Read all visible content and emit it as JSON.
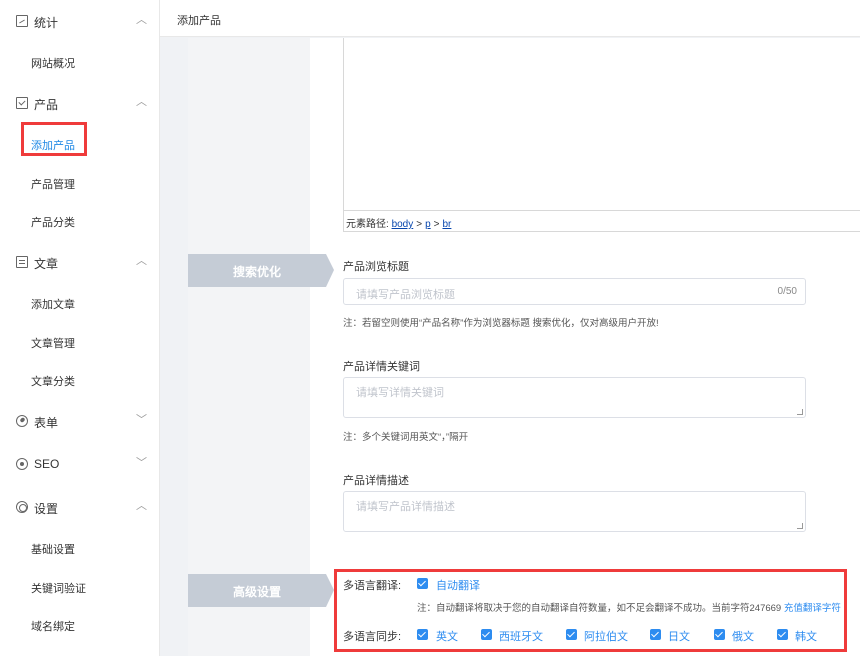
{
  "sidebar": {
    "groups": [
      {
        "label": "统计",
        "icon": "chart-icon",
        "expanded": true,
        "items": [
          "网站概况"
        ]
      },
      {
        "label": "产品",
        "icon": "box-icon",
        "expanded": true,
        "items": [
          "添加产品",
          "产品管理",
          "产品分类"
        ]
      },
      {
        "label": "文章",
        "icon": "document-icon",
        "expanded": true,
        "items": [
          "添加文章",
          "文章管理",
          "文章分类"
        ]
      },
      {
        "label": "表单",
        "icon": "check-circle-icon",
        "expanded": false,
        "items": []
      },
      {
        "label": "SEO",
        "icon": "target-icon",
        "expanded": false,
        "items": []
      },
      {
        "label": "设置",
        "icon": "gear-icon",
        "expanded": true,
        "items": [
          "基础设置",
          "关键词验证",
          "域名绑定"
        ]
      }
    ],
    "active_item": "添加产品"
  },
  "header": {
    "title": "添加产品"
  },
  "editor": {
    "path_label": "元素路径:",
    "path": [
      "body",
      "p",
      "br"
    ]
  },
  "seo": {
    "section_title": "搜索优化",
    "browse_title": {
      "label": "产品浏览标题",
      "placeholder": "请填写产品浏览标题",
      "counter": "0/50",
      "note": "注：若留空则使用“产品名称”作为浏览器标题  搜索优化，仅对高级用户开放!"
    },
    "keywords": {
      "label": "产品详情关键词",
      "placeholder": "请填写详情关键词",
      "note": "注：多个关键词用英文“，”隔开"
    },
    "description": {
      "label": "产品详情描述",
      "placeholder": "请填写产品详情描述"
    }
  },
  "advanced": {
    "section_title": "高级设置",
    "translate_label": "多语言翻译:",
    "auto_translate": "自动翻译",
    "translate_note": "注：自动翻译将取决于您的自动翻译自符数量，如不足会翻译不成功。当前字符247669",
    "recharge_link": "充值翻译字符",
    "sync_label": "多语言同步:",
    "languages": [
      "英文",
      "西班牙文",
      "阿拉伯文",
      "日文",
      "俄文",
      "韩文"
    ]
  },
  "colors": {
    "accent": "#2d8cf0",
    "highlight": "#ef3b3b",
    "section_tab": "#c5ccd6"
  }
}
